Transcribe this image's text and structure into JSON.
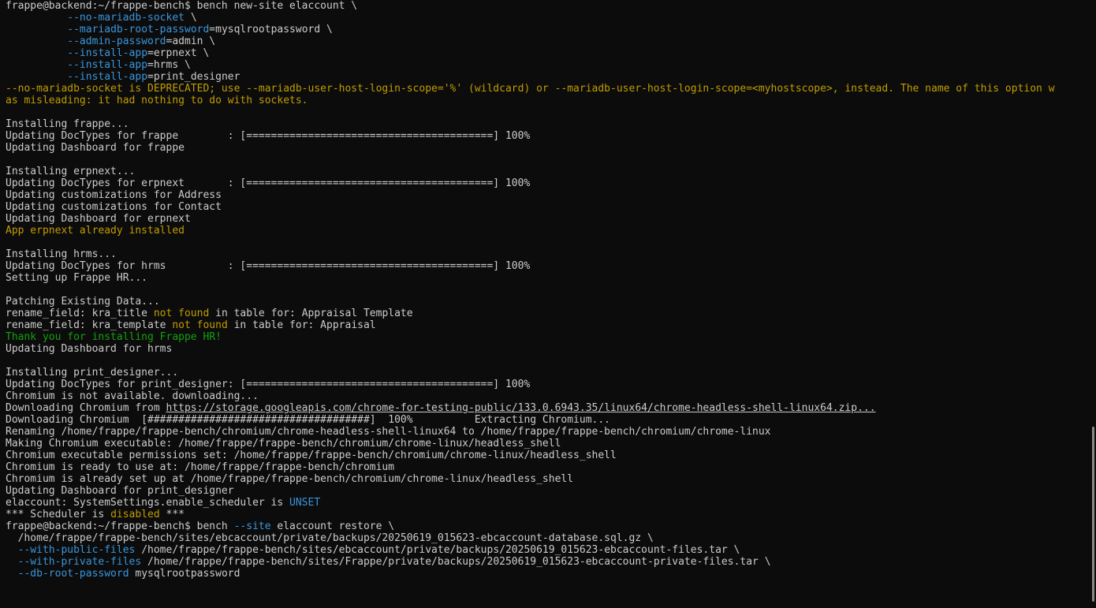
{
  "window": {
    "title": "frappe@backend: ~/frappe-bench"
  },
  "colors": {
    "background": "#0c0c0c",
    "foreground": "#cccccc",
    "blue": "#3a96dd",
    "yellow": "#c19c00",
    "green": "#13a10e"
  },
  "scrollbar": {
    "position": "bottom"
  },
  "lines": [
    [
      {
        "t": "frappe@backend:~/frappe-bench$ bench new-site elaccount \\",
        "c": "default"
      }
    ],
    [
      {
        "t": "          ",
        "c": "default"
      },
      {
        "t": "--no-mariadb-socket",
        "c": "blue"
      },
      {
        "t": " \\",
        "c": "default"
      }
    ],
    [
      {
        "t": "          ",
        "c": "default"
      },
      {
        "t": "--mariadb-root-password",
        "c": "blue"
      },
      {
        "t": "=mysqlrootpassword \\",
        "c": "default"
      }
    ],
    [
      {
        "t": "          ",
        "c": "default"
      },
      {
        "t": "--admin-password",
        "c": "blue"
      },
      {
        "t": "=admin \\",
        "c": "default"
      }
    ],
    [
      {
        "t": "          ",
        "c": "default"
      },
      {
        "t": "--install-app",
        "c": "blue"
      },
      {
        "t": "=erpnext \\",
        "c": "default"
      }
    ],
    [
      {
        "t": "          ",
        "c": "default"
      },
      {
        "t": "--install-app",
        "c": "blue"
      },
      {
        "t": "=hrms \\",
        "c": "default"
      }
    ],
    [
      {
        "t": "          ",
        "c": "default"
      },
      {
        "t": "--install-app",
        "c": "blue"
      },
      {
        "t": "=print_designer",
        "c": "default"
      }
    ],
    [
      {
        "t": "--no-mariadb-socket is DEPRECATED; use --mariadb-user-host-login-scope='%' (wildcard) or --mariadb-user-host-login-scope=<myhostscope>, instead. The name of this option w",
        "c": "yellow"
      }
    ],
    [
      {
        "t": "as misleading: it had nothing to do with sockets.",
        "c": "yellow"
      }
    ],
    [
      {
        "t": "",
        "c": "default"
      }
    ],
    [
      {
        "t": "Installing frappe...",
        "c": "default"
      }
    ],
    [
      {
        "t": "Updating DocTypes for frappe        : [========================================] 100%",
        "c": "default"
      }
    ],
    [
      {
        "t": "Updating Dashboard for frappe",
        "c": "default"
      }
    ],
    [
      {
        "t": "",
        "c": "default"
      }
    ],
    [
      {
        "t": "Installing erpnext...",
        "c": "default"
      }
    ],
    [
      {
        "t": "Updating DocTypes for erpnext       : [========================================] 100%",
        "c": "default"
      }
    ],
    [
      {
        "t": "Updating customizations for Address",
        "c": "default"
      }
    ],
    [
      {
        "t": "Updating customizations for Contact",
        "c": "default"
      }
    ],
    [
      {
        "t": "Updating Dashboard for erpnext",
        "c": "default"
      }
    ],
    [
      {
        "t": "App erpnext already installed",
        "c": "yellow"
      }
    ],
    [
      {
        "t": "",
        "c": "default"
      }
    ],
    [
      {
        "t": "Installing hrms...",
        "c": "default"
      }
    ],
    [
      {
        "t": "Updating DocTypes for hrms          : [========================================] 100%",
        "c": "default"
      }
    ],
    [
      {
        "t": "Setting up Frappe HR...",
        "c": "default"
      }
    ],
    [
      {
        "t": "",
        "c": "default"
      }
    ],
    [
      {
        "t": "Patching Existing Data...",
        "c": "default"
      }
    ],
    [
      {
        "t": "rename_field: kra_title ",
        "c": "default"
      },
      {
        "t": "not found",
        "c": "yellow"
      },
      {
        "t": " in table for: Appraisal Template",
        "c": "default"
      }
    ],
    [
      {
        "t": "rename_field: kra_template ",
        "c": "default"
      },
      {
        "t": "not found",
        "c": "yellow"
      },
      {
        "t": " in table for: Appraisal",
        "c": "default"
      }
    ],
    [
      {
        "t": "Thank you for installing Frappe HR!",
        "c": "green"
      }
    ],
    [
      {
        "t": "Updating Dashboard for hrms",
        "c": "default"
      }
    ],
    [
      {
        "t": "",
        "c": "default"
      }
    ],
    [
      {
        "t": "Installing print_designer...",
        "c": "default"
      }
    ],
    [
      {
        "t": "Updating DocTypes for print_designer: [========================================] 100%",
        "c": "default"
      }
    ],
    [
      {
        "t": "Chromium is not available. downloading...",
        "c": "default"
      }
    ],
    [
      {
        "t": "Downloading Chromium from ",
        "c": "default"
      },
      {
        "t": "https://storage.googleapis.com/chrome-for-testing-public/133.0.6943.35/linux64/chrome-headless-shell-linux64.zip...",
        "c": "link"
      }
    ],
    [
      {
        "t": "Downloading Chromium  [####################################]  100%          Extracting Chromium...",
        "c": "default"
      }
    ],
    [
      {
        "t": "Renaming /home/frappe/frappe-bench/chromium/chrome-headless-shell-linux64 to /home/frappe/frappe-bench/chromium/chrome-linux",
        "c": "default"
      }
    ],
    [
      {
        "t": "Making Chromium executable: /home/frappe/frappe-bench/chromium/chrome-linux/headless_shell",
        "c": "default"
      }
    ],
    [
      {
        "t": "Chromium executable permissions set: /home/frappe/frappe-bench/chromium/chrome-linux/headless_shell",
        "c": "default"
      }
    ],
    [
      {
        "t": "Chromium is ready to use at: /home/frappe/frappe-bench/chromium",
        "c": "default"
      }
    ],
    [
      {
        "t": "Chromium is already set up at /home/frappe/frappe-bench/chromium/chrome-linux/headless_shell",
        "c": "default"
      }
    ],
    [
      {
        "t": "Updating Dashboard for print_designer",
        "c": "default"
      }
    ],
    [
      {
        "t": "elaccount: SystemSettings.enable_scheduler is ",
        "c": "default"
      },
      {
        "t": "UNSET",
        "c": "blue"
      }
    ],
    [
      {
        "t": "*** Scheduler is ",
        "c": "default"
      },
      {
        "t": "disabled",
        "c": "yellow"
      },
      {
        "t": " ***",
        "c": "default"
      }
    ],
    [
      {
        "t": "frappe@backend:~/frappe-bench$ bench ",
        "c": "default"
      },
      {
        "t": "--site",
        "c": "blue"
      },
      {
        "t": " elaccount restore \\",
        "c": "default"
      }
    ],
    [
      {
        "t": "  /home/frappe/frappe-bench/sites/ebcaccount/private/backups/20250619_015623-ebcaccount-database.sql.gz \\",
        "c": "default"
      }
    ],
    [
      {
        "t": "  ",
        "c": "default"
      },
      {
        "t": "--with-public-files",
        "c": "blue"
      },
      {
        "t": " /home/frappe/frappe-bench/sites/ebcaccount/private/backups/20250619_015623-ebcaccount-files.tar \\",
        "c": "default"
      }
    ],
    [
      {
        "t": "  ",
        "c": "default"
      },
      {
        "t": "--with-private-files",
        "c": "blue"
      },
      {
        "t": " /home/frappe/frappe-bench/sites/Frappe/private/backups/20250619_015623-ebcaccount-private-files.tar \\",
        "c": "default"
      }
    ],
    [
      {
        "t": "  ",
        "c": "default"
      },
      {
        "t": "--db-root-password",
        "c": "blue"
      },
      {
        "t": " mysqlrootpassword",
        "c": "default"
      }
    ]
  ]
}
